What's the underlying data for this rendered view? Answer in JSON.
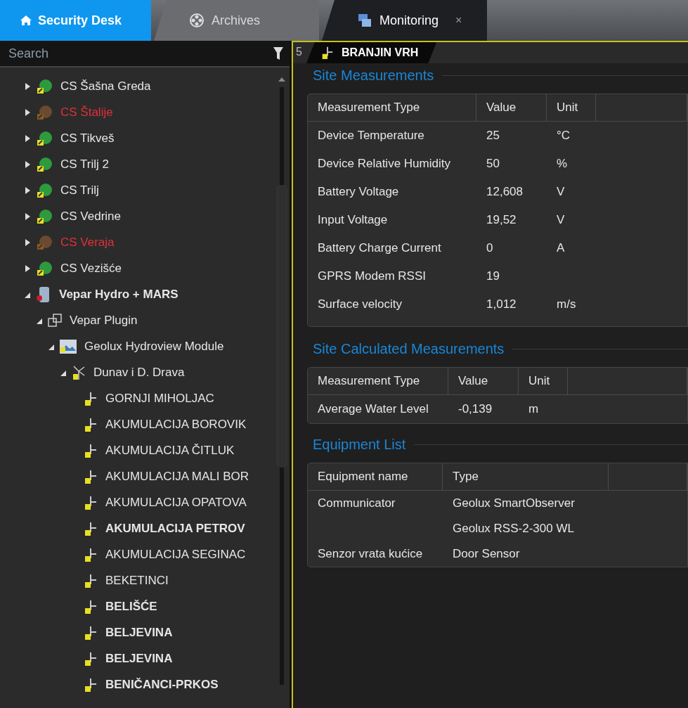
{
  "home_button": {
    "label": "Security Desk"
  },
  "tabs": [
    {
      "label": "Archives",
      "selected": false,
      "closable": false
    },
    {
      "label": "Monitoring",
      "selected": true,
      "closable": true
    }
  ],
  "close_glyph": "×",
  "search": {
    "placeholder": "Search"
  },
  "tree": [
    {
      "label": "CS Šašna Greda",
      "kind": "station",
      "offline": false,
      "bold": false,
      "expanded": false
    },
    {
      "label": "CS Štalije",
      "kind": "station",
      "offline": true,
      "bold": false,
      "expanded": false
    },
    {
      "label": "CS Tikveš",
      "kind": "station",
      "offline": false,
      "bold": false,
      "expanded": false
    },
    {
      "label": "CS Trilj 2",
      "kind": "station",
      "offline": false,
      "bold": false,
      "expanded": false
    },
    {
      "label": "CS Trilj",
      "kind": "station",
      "offline": false,
      "bold": false,
      "expanded": false
    },
    {
      "label": "CS Vedrine",
      "kind": "station",
      "offline": false,
      "bold": false,
      "expanded": false
    },
    {
      "label": "CS Veraja",
      "kind": "station",
      "offline": true,
      "bold": false,
      "expanded": false
    },
    {
      "label": "CS Vezišće",
      "kind": "station",
      "offline": false,
      "bold": false,
      "expanded": false
    },
    {
      "label": "Vepar Hydro + MARS",
      "kind": "server",
      "offline": false,
      "bold": true,
      "expanded": true,
      "children": [
        {
          "label": "Vepar Plugin",
          "kind": "plugin",
          "offline": false,
          "bold": false,
          "expanded": true,
          "children": [
            {
              "label": "Geolux Hydroview Module",
              "kind": "module",
              "offline": false,
              "bold": false,
              "expanded": true,
              "children": [
                {
                  "label": "Dunav i D. Drava",
                  "kind": "area",
                  "offline": false,
                  "bold": false,
                  "expanded": true,
                  "children": [
                    {
                      "label": "GORNJI MIHOLJAC",
                      "kind": "site",
                      "offline": false,
                      "bold": false
                    },
                    {
                      "label": "AKUMULACIJA BOROVIK",
                      "kind": "site",
                      "offline": false,
                      "bold": false
                    },
                    {
                      "label": "AKUMULACIJA ČITLUK",
                      "kind": "site",
                      "offline": false,
                      "bold": false
                    },
                    {
                      "label": "AKUMULACIJA MALI BOR",
                      "kind": "site",
                      "offline": false,
                      "bold": false
                    },
                    {
                      "label": "AKUMULACIJA OPATOVA",
                      "kind": "site",
                      "offline": false,
                      "bold": false
                    },
                    {
                      "label": "AKUMULACIJA PETROV",
                      "kind": "site",
                      "offline": false,
                      "bold": true
                    },
                    {
                      "label": "AKUMULACIJA SEGINAC",
                      "kind": "site",
                      "offline": false,
                      "bold": false
                    },
                    {
                      "label": "BEKETINCI",
                      "kind": "site",
                      "offline": false,
                      "bold": false
                    },
                    {
                      "label": "BELIŠĆE",
                      "kind": "site",
                      "offline": false,
                      "bold": true
                    },
                    {
                      "label": "BELJEVINA",
                      "kind": "site",
                      "offline": false,
                      "bold": true
                    },
                    {
                      "label": "BELJEVINA",
                      "kind": "site",
                      "offline": false,
                      "bold": true
                    },
                    {
                      "label": "BENIČANCI-PRKOS",
                      "kind": "site",
                      "offline": false,
                      "bold": true
                    }
                  ]
                }
              ]
            }
          ]
        }
      ]
    }
  ],
  "monitor": {
    "tile_number": "5",
    "tile_title": "BRANJIN VRH",
    "site_measurements": {
      "title": "Site Measurements",
      "columns": [
        "Measurement Type",
        "Value",
        "Unit"
      ],
      "rows": [
        {
          "type": "Device Temperature",
          "value": "25",
          "unit": "°C"
        },
        {
          "type": "Device Relative Humidity",
          "value": "50",
          "unit": "%"
        },
        {
          "type": "Battery Voltage",
          "value": "12,608",
          "unit": "V"
        },
        {
          "type": "Input Voltage",
          "value": "19,52",
          "unit": "V"
        },
        {
          "type": "Battery Charge Current",
          "value": "0",
          "unit": "A"
        },
        {
          "type": "GPRS Modem RSSI",
          "value": "19"
        },
        {
          "type": "Surface velocity",
          "value": "1,012",
          "unit": "m/s"
        }
      ]
    },
    "calculated_measurements": {
      "title": "Site Calculated Measurements",
      "columns": [
        "Measurement Type",
        "Value",
        "Unit"
      ],
      "rows": [
        {
          "type": "Average Water Level",
          "value": "-0,139",
          "unit": "m"
        }
      ]
    },
    "equipment": {
      "title": "Equipment List",
      "columns": [
        "Equipment name",
        "Type"
      ],
      "rows": [
        {
          "name": "Communicator",
          "type": "Geolux SmartObserver"
        },
        {
          "type": "Geolux RSS-2-300 WL"
        },
        {
          "name": "Senzor vrata kućice",
          "type": "Door Sensor"
        }
      ]
    }
  }
}
